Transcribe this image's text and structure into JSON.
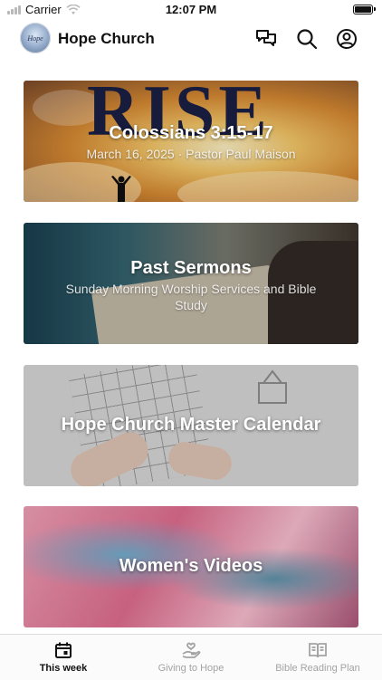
{
  "status": {
    "carrier": "Carrier",
    "time": "12:07 PM"
  },
  "header": {
    "logo_text": "Hope",
    "title": "Hope Church",
    "icons": [
      "chat-icon",
      "search-icon",
      "account-icon"
    ]
  },
  "cards": [
    {
      "art_text": "RISE",
      "title": "Colossians 3:15-17",
      "subtitle": "March 16, 2025 · Pastor Paul Maison"
    },
    {
      "title": "Past Sermons",
      "subtitle": "Sunday Morning Worship Services and Bible Study"
    },
    {
      "title": "Hope Church Master Calendar"
    },
    {
      "title": "Women's Videos"
    }
  ],
  "tabs": [
    {
      "label": "This week",
      "icon": "calendar-icon",
      "active": true
    },
    {
      "label": "Giving to Hope",
      "icon": "giving-hand-icon",
      "active": false
    },
    {
      "label": "Bible Reading Plan",
      "icon": "book-icon",
      "active": false
    }
  ],
  "colors": {
    "active_tab": "#111111",
    "inactive_tab": "#a3a3a3"
  }
}
